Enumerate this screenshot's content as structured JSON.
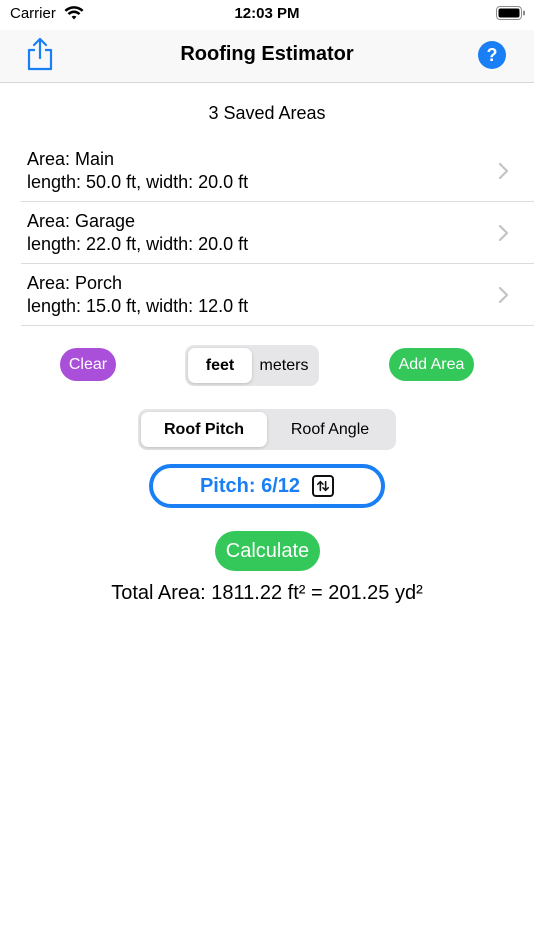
{
  "status": {
    "carrier": "Carrier",
    "time": "12:03 PM"
  },
  "nav": {
    "title": "Roofing Estimator",
    "help_label": "?"
  },
  "saved": {
    "count_label": "3 Saved Areas",
    "areas": [
      {
        "name": "Area: Main",
        "dims": "length: 50.0 ft, width: 20.0 ft"
      },
      {
        "name": "Area: Garage",
        "dims": "length: 22.0 ft, width: 20.0 ft"
      },
      {
        "name": "Area: Porch",
        "dims": "length: 15.0 ft, width: 12.0 ft"
      }
    ]
  },
  "controls": {
    "clear_label": "Clear",
    "units": [
      "feet",
      "meters"
    ],
    "add_area_label": "Add Area",
    "modes": [
      "Roof Pitch",
      "Roof Angle"
    ],
    "pitch_label": "Pitch: 6/12",
    "calculate_label": "Calculate"
  },
  "result": {
    "total_label": "Total Area: 1811.22 ft² = 201.25 yd²"
  },
  "colors": {
    "accent_blue": "#1a7ff5",
    "clear_purple": "#a94fd9",
    "action_green": "#34c759"
  }
}
